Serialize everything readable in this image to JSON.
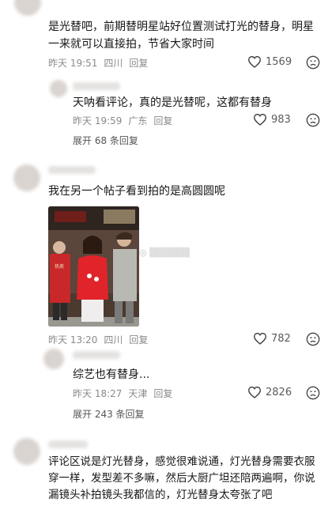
{
  "comments": [
    {
      "text": "是光替吧，前期替明星站好位置测试打光的替身，明星一来就可以直接拍，节省大家时间",
      "time": "昨天 19:51",
      "location": "四川",
      "reply_label": "回复",
      "likes": "1569"
    },
    {
      "text": "天呐看评论，真的是光替呢，这都有替身",
      "time": "昨天 19:59",
      "location": "广东",
      "reply_label": "回复",
      "likes": "983"
    },
    {
      "expand_label": "展开 68 条回复"
    },
    {
      "text": "我在另一个帖子看到拍的是高圆圆呢",
      "time": "昨天 13:20",
      "location": "四川",
      "reply_label": "回复",
      "likes": "782",
      "photo_sign": "热卖"
    },
    {
      "text": "综艺也有替身...",
      "time": "昨天 18:27",
      "location": "天津",
      "reply_label": "回复",
      "likes": "2826"
    },
    {
      "expand_label": "展开 243 条回复"
    },
    {
      "text": "评论区说是灯光替身，感觉很难说通，灯光替身需要衣服穿一样，发型差不多嘛，然后大厨广坦还陪两遍啊，你说漏镜头补拍镜头我都信的，灯光替身太夸张了吧"
    }
  ],
  "icons": {
    "like": "heart-outline-icon",
    "dislike": "dislike-face-icon"
  },
  "colors": {
    "meta_text": "#8a8a8a",
    "body_text": "#161616",
    "background": "#ffffff"
  }
}
